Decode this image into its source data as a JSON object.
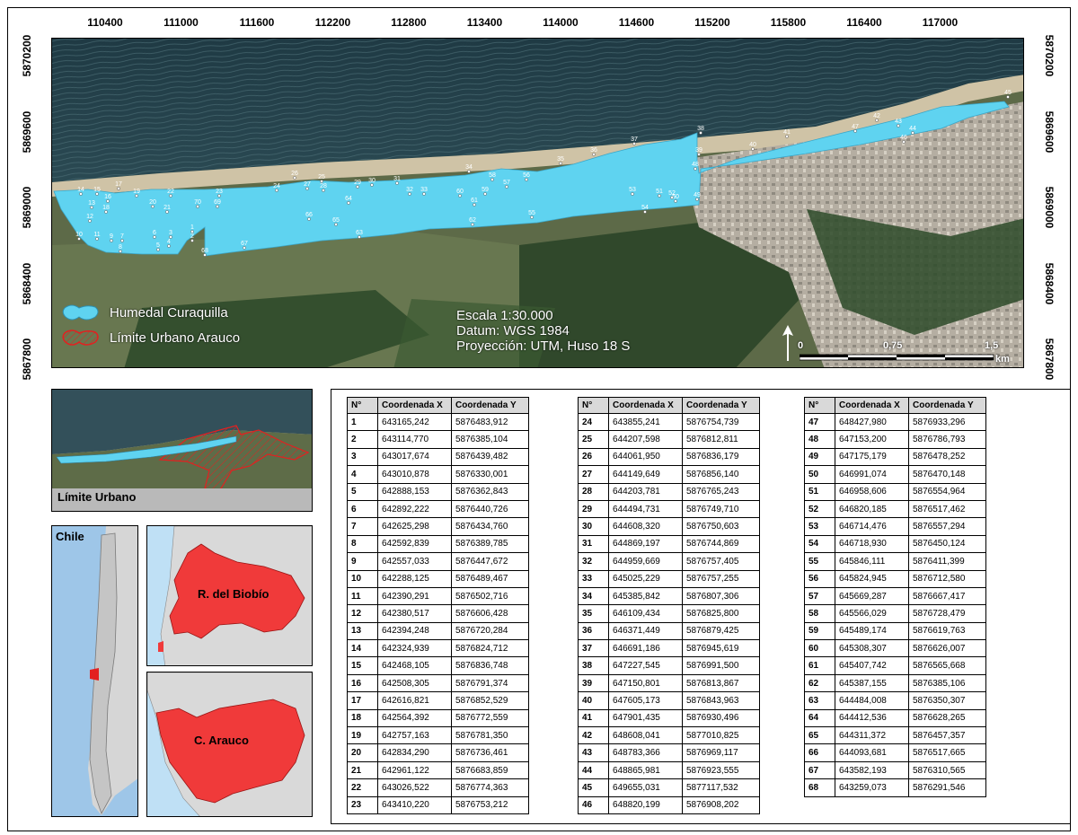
{
  "map": {
    "x_ticks": [
      "110400",
      "111000",
      "111600",
      "112200",
      "112800",
      "113400",
      "114000",
      "114600",
      "115200",
      "115800",
      "116400",
      "117000"
    ],
    "y_ticks": [
      "5870200",
      "5869600",
      "5869000",
      "5868400",
      "5867800"
    ],
    "legend": [
      {
        "label": "Humedal Curaquilla",
        "color": "#5fd3f0"
      },
      {
        "label": "Límite Urbano Arauco",
        "color": "#e32020"
      }
    ],
    "info": {
      "scale": "Escala 1:30.000",
      "datum": "Datum: WGS 1984",
      "projection": "Proyección: UTM, Huso 18 S"
    },
    "scalebar": {
      "labels": [
        "0",
        "0,75",
        "1,5"
      ],
      "unit": "km"
    },
    "point_labels": [
      "1",
      "2",
      "3",
      "4",
      "5",
      "6",
      "7",
      "8",
      "9",
      "10",
      "11",
      "12",
      "13",
      "14",
      "15",
      "16",
      "17",
      "18",
      "19",
      "20",
      "21",
      "22",
      "23",
      "24",
      "25",
      "26",
      "27",
      "28",
      "29",
      "30",
      "31",
      "32",
      "33",
      "34",
      "35",
      "36",
      "37",
      "38",
      "39",
      "40",
      "41",
      "42",
      "43",
      "44",
      "45",
      "46",
      "47",
      "48",
      "49",
      "50",
      "51",
      "52",
      "53",
      "54",
      "55",
      "56",
      "57",
      "58",
      "59",
      "60",
      "61",
      "62",
      "63",
      "64",
      "65",
      "66",
      "67",
      "68",
      "69",
      "70"
    ]
  },
  "insets": {
    "urban": "Límite Urbano",
    "chile": "Chile",
    "biobio": "R. del Biobío",
    "arauco": "C. Arauco"
  },
  "table": {
    "headers": [
      "N°",
      "Coordenada X",
      "Coordenada Y"
    ],
    "columns": [
      [
        [
          "1",
          "643165,242",
          "5876483,912"
        ],
        [
          "2",
          "643114,770",
          "5876385,104"
        ],
        [
          "3",
          "643017,674",
          "5876439,482"
        ],
        [
          "4",
          "643010,878",
          "5876330,001"
        ],
        [
          "5",
          "642888,153",
          "5876362,843"
        ],
        [
          "6",
          "642892,222",
          "5876440,726"
        ],
        [
          "7",
          "642625,298",
          "5876434,760"
        ],
        [
          "8",
          "642592,839",
          "5876389,785"
        ],
        [
          "9",
          "642557,033",
          "5876447,672"
        ],
        [
          "10",
          "642288,125",
          "5876489,467"
        ],
        [
          "11",
          "642390,291",
          "5876502,716"
        ],
        [
          "12",
          "642380,517",
          "5876606,428"
        ],
        [
          "13",
          "642394,248",
          "5876720,284"
        ],
        [
          "14",
          "642324,939",
          "5876824,712"
        ],
        [
          "15",
          "642468,105",
          "5876836,748"
        ],
        [
          "16",
          "642508,305",
          "5876791,374"
        ],
        [
          "17",
          "642616,821",
          "5876852,529"
        ],
        [
          "18",
          "642564,392",
          "5876772,559"
        ],
        [
          "19",
          "642757,163",
          "5876781,350"
        ],
        [
          "20",
          "642834,290",
          "5876736,461"
        ],
        [
          "21",
          "642961,122",
          "5876683,859"
        ],
        [
          "22",
          "643026,522",
          "5876774,363"
        ],
        [
          "23",
          "643410,220",
          "5876753,212"
        ]
      ],
      [
        [
          "24",
          "643855,241",
          "5876754,739"
        ],
        [
          "25",
          "644207,598",
          "5876812,811"
        ],
        [
          "26",
          "644061,950",
          "5876836,179"
        ],
        [
          "27",
          "644149,649",
          "5876856,140"
        ],
        [
          "28",
          "644203,781",
          "5876765,243"
        ],
        [
          "29",
          "644494,731",
          "5876749,710"
        ],
        [
          "30",
          "644608,320",
          "5876750,603"
        ],
        [
          "31",
          "644869,197",
          "5876744,869"
        ],
        [
          "32",
          "644959,669",
          "5876757,405"
        ],
        [
          "33",
          "645025,229",
          "5876757,255"
        ],
        [
          "34",
          "645385,842",
          "5876807,306"
        ],
        [
          "35",
          "646109,434",
          "5876825,800"
        ],
        [
          "36",
          "646371,449",
          "5876879,425"
        ],
        [
          "37",
          "646691,186",
          "5876945,619"
        ],
        [
          "38",
          "647227,545",
          "5876991,500"
        ],
        [
          "39",
          "647150,801",
          "5876813,867"
        ],
        [
          "40",
          "647605,173",
          "5876843,963"
        ],
        [
          "41",
          "647901,435",
          "5876930,496"
        ],
        [
          "42",
          "648608,041",
          "5877010,825"
        ],
        [
          "43",
          "648783,366",
          "5876969,117"
        ],
        [
          "44",
          "648865,981",
          "5876923,555"
        ],
        [
          "45",
          "649655,031",
          "5877117,532"
        ],
        [
          "46",
          "648820,199",
          "5876908,202"
        ]
      ],
      [
        [
          "47",
          "648427,980",
          "5876933,296"
        ],
        [
          "48",
          "647153,200",
          "5876786,793"
        ],
        [
          "49",
          "647175,179",
          "5876478,252"
        ],
        [
          "50",
          "646991,074",
          "5876470,148"
        ],
        [
          "51",
          "646958,606",
          "5876554,964"
        ],
        [
          "52",
          "646820,185",
          "5876517,462"
        ],
        [
          "53",
          "646714,476",
          "5876557,294"
        ],
        [
          "54",
          "646718,930",
          "5876450,124"
        ],
        [
          "55",
          "645846,111",
          "5876411,399"
        ],
        [
          "56",
          "645824,945",
          "5876712,580"
        ],
        [
          "57",
          "645669,287",
          "5876667,417"
        ],
        [
          "58",
          "645566,029",
          "5876728,479"
        ],
        [
          "59",
          "645489,174",
          "5876619,763"
        ],
        [
          "60",
          "645308,307",
          "5876626,007"
        ],
        [
          "61",
          "645407,742",
          "5876565,668"
        ],
        [
          "62",
          "645387,155",
          "5876385,106"
        ],
        [
          "63",
          "644484,008",
          "5876350,307"
        ],
        [
          "64",
          "644412,536",
          "5876628,265"
        ],
        [
          "65",
          "644311,372",
          "5876457,357"
        ],
        [
          "66",
          "644093,681",
          "5876517,665"
        ],
        [
          "67",
          "643582,193",
          "5876310,565"
        ],
        [
          "68",
          "643259,073",
          "5876291,546"
        ]
      ]
    ]
  }
}
